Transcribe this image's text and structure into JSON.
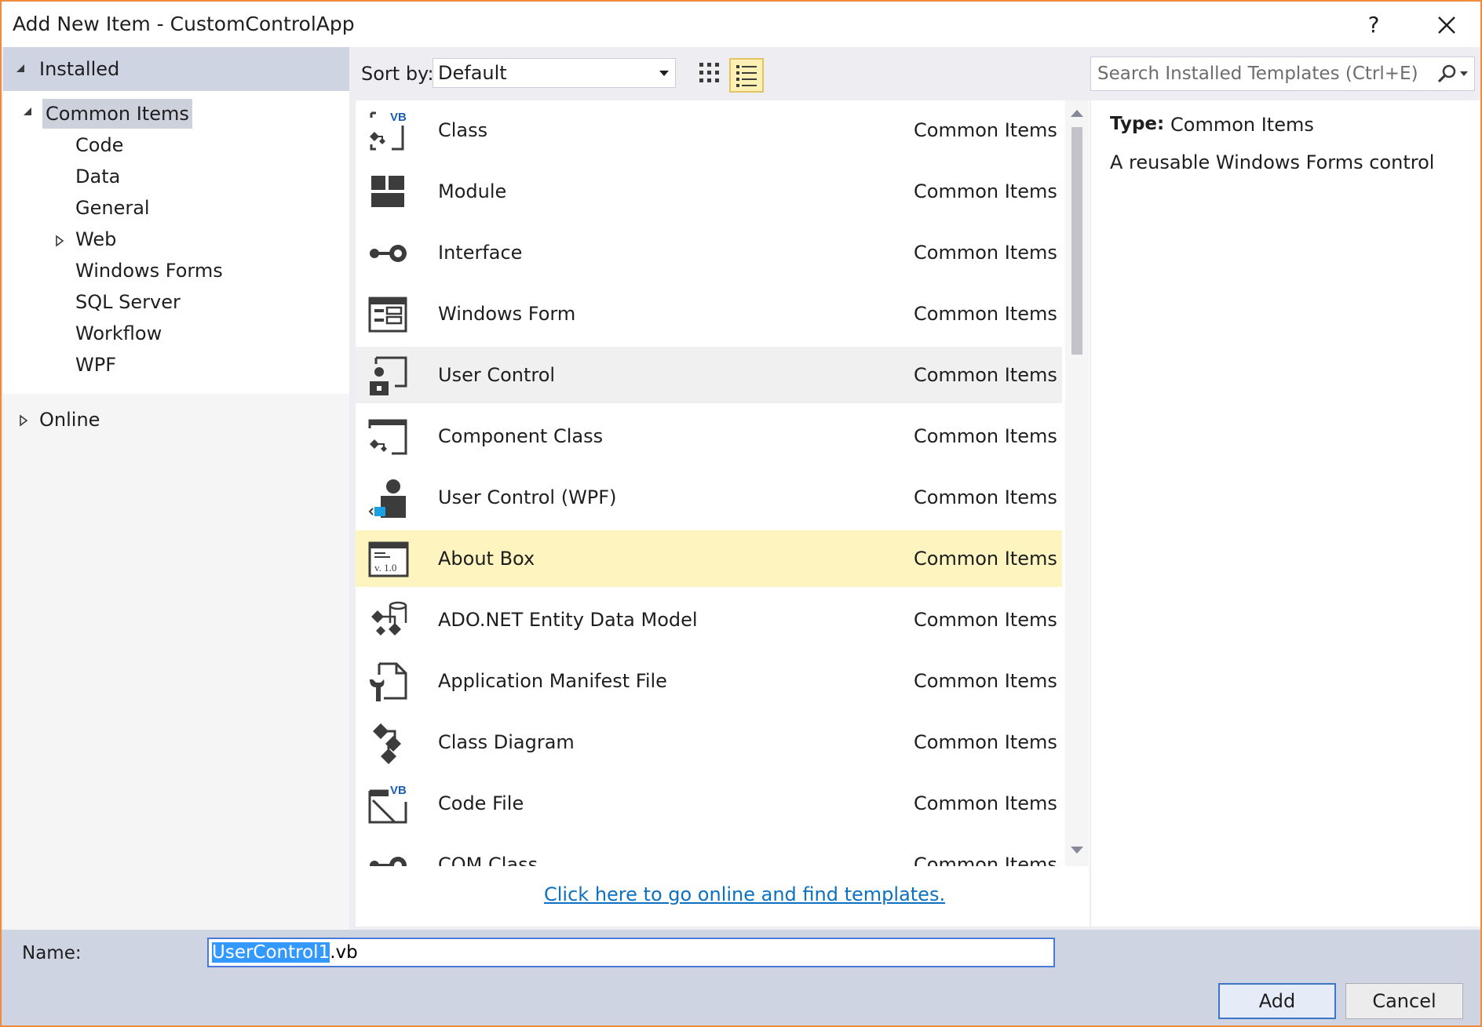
{
  "window": {
    "title": "Add New Item - CustomControlApp",
    "help_label": "?"
  },
  "tree": {
    "installed_label": "Installed",
    "common_items_label": "Common Items",
    "children": [
      {
        "label": "Code"
      },
      {
        "label": "Data"
      },
      {
        "label": "General"
      },
      {
        "label": "Web"
      },
      {
        "label": "Windows Forms"
      },
      {
        "label": "SQL Server"
      },
      {
        "label": "Workflow"
      },
      {
        "label": "WPF"
      }
    ],
    "online_label": "Online"
  },
  "toolbar": {
    "sort_label": "Sort by:",
    "sort_value": "Default",
    "search_placeholder": "Search Installed Templates (Ctrl+E)"
  },
  "templates": [
    {
      "name": "Class",
      "category": "Common Items",
      "icon": "class-vb-icon"
    },
    {
      "name": "Module",
      "category": "Common Items",
      "icon": "module-icon"
    },
    {
      "name": "Interface",
      "category": "Common Items",
      "icon": "interface-icon"
    },
    {
      "name": "Windows Form",
      "category": "Common Items",
      "icon": "windows-form-icon"
    },
    {
      "name": "User Control",
      "category": "Common Items",
      "icon": "user-control-icon"
    },
    {
      "name": "Component Class",
      "category": "Common Items",
      "icon": "component-class-icon"
    },
    {
      "name": "User Control (WPF)",
      "category": "Common Items",
      "icon": "user-control-wpf-icon"
    },
    {
      "name": "About Box",
      "category": "Common Items",
      "icon": "about-box-icon"
    },
    {
      "name": "ADO.NET Entity Data Model",
      "category": "Common Items",
      "icon": "entity-data-model-icon"
    },
    {
      "name": "Application Manifest File",
      "category": "Common Items",
      "icon": "manifest-file-icon"
    },
    {
      "name": "Class Diagram",
      "category": "Common Items",
      "icon": "class-diagram-icon"
    },
    {
      "name": "Code File",
      "category": "Common Items",
      "icon": "code-file-vb-icon"
    },
    {
      "name": "COM Class",
      "category": "Common Items",
      "icon": "com-class-icon"
    }
  ],
  "about_box_version": "v. 1.0",
  "vb_badge": "VB",
  "online_link": "Click here to go online and find templates.",
  "info": {
    "type_label": "Type:",
    "type_value": "Common Items",
    "description": "A reusable Windows Forms control"
  },
  "footer": {
    "name_label": "Name:",
    "name_value": "UserControl1.vb",
    "add_label": "Add",
    "cancel_label": "Cancel"
  },
  "colors": {
    "accent_border": "#f08a3c",
    "selection_highlight": "#fdf4bf",
    "link": "#0e70c0",
    "vb_blue": "#1c5fb0",
    "wpf_blue": "#1ba1e2"
  }
}
